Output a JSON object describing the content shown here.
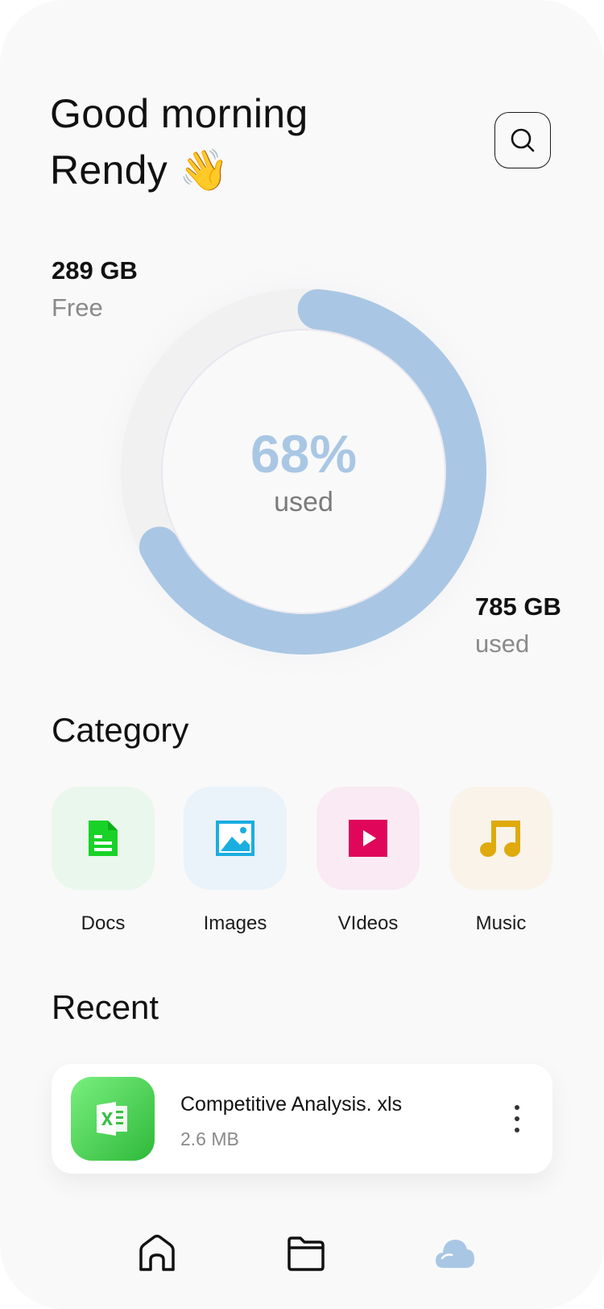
{
  "greeting": {
    "line1": "Good morning",
    "line2": "Rendy 👋"
  },
  "search": {
    "icon": "search-icon"
  },
  "storage": {
    "free_value": "289 GB",
    "free_label": "Free",
    "used_value": "785 GB",
    "used_label": "used",
    "percent_text": "68%",
    "percent_caption": "used",
    "used_fraction": 0.68,
    "colors": {
      "arc": "#a9c7e4",
      "track": "#f1f1f1"
    }
  },
  "category": {
    "title": "Category",
    "items": [
      {
        "label": "Docs",
        "icon": "document-icon",
        "tile_color": "#eaf7ec",
        "icon_color": "#19d227"
      },
      {
        "label": "Images",
        "icon": "image-icon",
        "tile_color": "#eaf2fa",
        "icon_color": "#1aaee0"
      },
      {
        "label": "VIdeos",
        "icon": "video-icon",
        "tile_color": "#f9eaf3",
        "icon_color": "#e0075a"
      },
      {
        "label": "Music",
        "icon": "music-icon",
        "tile_color": "#f9f3ea",
        "icon_color": "#deaa0d"
      }
    ]
  },
  "recent": {
    "title": "Recent",
    "files": [
      {
        "name": "Competitive Analysis. xls",
        "size": "2.6 MB",
        "icon": "excel-file-icon"
      }
    ]
  },
  "nav": {
    "items": [
      {
        "icon": "home-icon",
        "active": false
      },
      {
        "icon": "folder-icon",
        "active": false
      },
      {
        "icon": "cloud-icon",
        "active": true
      }
    ],
    "active_color": "#a9c7e4",
    "inactive_color": "#111111"
  }
}
